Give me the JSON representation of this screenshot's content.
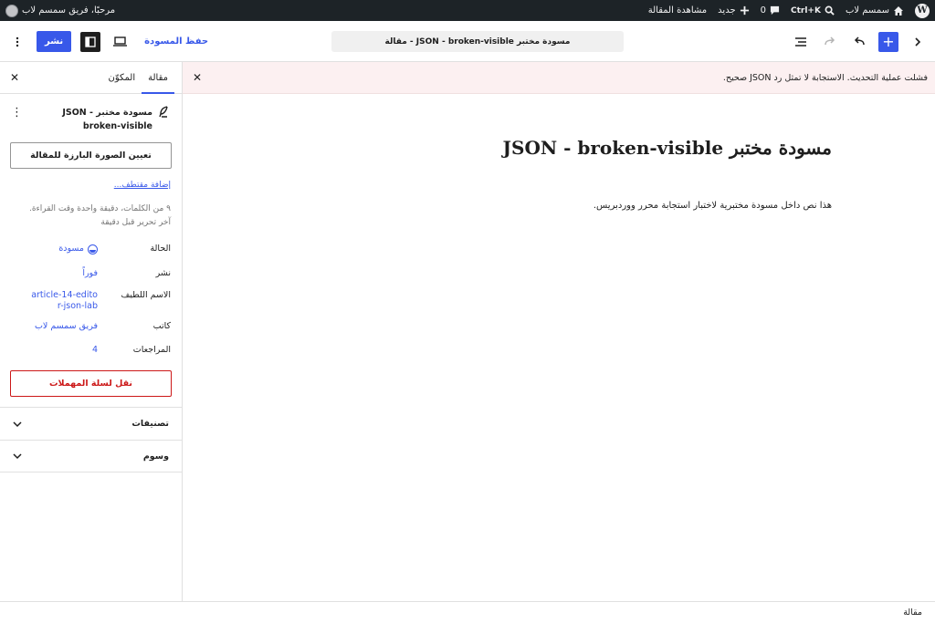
{
  "admin_bar": {
    "site_name": "سمسم لاب",
    "shortcut": "Ctrl+K",
    "comments_count": "0",
    "new_label": "جديد",
    "view_post": "مشاهدة المقالة",
    "greeting": "مرحبًا، فريق سمسم لاب"
  },
  "header": {
    "document_title": "مسودة مختبر JSON - broken-visible - مقالة",
    "save_draft": "حفظ المسودة",
    "publish": "نشر"
  },
  "notice": {
    "message": "فشلت عملية التحديث. الاستجابة لا تمثل رد JSON صحيح."
  },
  "post": {
    "title": "مسودة مختبر JSON - broken-visible",
    "paragraph": "هذا نص داخل مسودة مختبرية لاختبار استجابة محرر ووردبريس."
  },
  "sidebar": {
    "tab_post": "مقالة",
    "tab_block": "المكوّن",
    "post_title": "مسودة مختبر JSON - broken-visible",
    "featured_image": "تعيين الصورة البارزة للمقالة",
    "add_excerpt": "إضافة مقتطف...",
    "word_stats": "٩ من الكلمات، دقيقة واحدة وقت القراءة.",
    "last_edited": "آخر تحرير قبل دقيقة",
    "status_label": "الحالة",
    "status_value": "مسودة",
    "publish_label": "نشر",
    "publish_value": "فوراً",
    "slug_label": "الاسم اللطيف",
    "slug_value": "article-14-editor-json-lab",
    "author_label": "كاتب",
    "author_value": "فريق سمسم لاب",
    "revisions_label": "المراجعات",
    "revisions_value": "4",
    "trash": "نقل لسلة المهملات",
    "categories": "تصنيفات",
    "tags": "وسوم"
  },
  "footer": {
    "breadcrumb": "مقالة"
  },
  "colors": {
    "accent": "#3858e9",
    "admin_bar": "#1d2327",
    "notice_bg": "#fcf0f1",
    "danger": "#cc1818"
  }
}
